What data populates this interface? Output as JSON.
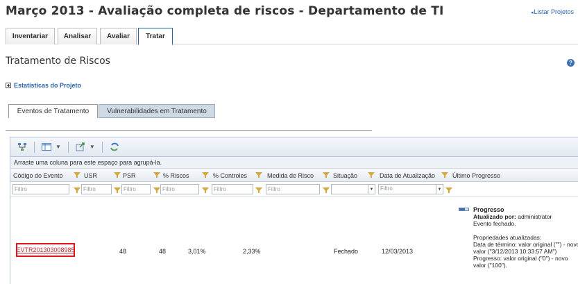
{
  "page": {
    "title": "Março 2013 - Avaliação completa de riscos - Departamento de TI",
    "list_link": "Listar Projetos"
  },
  "main_tabs": [
    {
      "label": "Inventariar"
    },
    {
      "label": "Analisar"
    },
    {
      "label": "Avaliar"
    },
    {
      "label": "Tratar",
      "active": true
    }
  ],
  "section": {
    "title": "Tratamento de Riscos",
    "stats_link": "Estatísticas do Projeto"
  },
  "sub_tabs": [
    {
      "label": "Eventos de Tratamento",
      "active": true
    },
    {
      "label": "Vulnerabilidades em Tratamento"
    }
  ],
  "toolbar": {
    "icons": [
      "hierarchy-icon",
      "columns-icon",
      "export-icon",
      "refresh-icon"
    ]
  },
  "grid": {
    "group_hint": "Arraste uma coluna para este espaço para agrupá-la.",
    "columns": [
      "Código do Evento",
      "USR",
      "PSR",
      "% Riscos",
      "% Controles",
      "Medida de Risco",
      "Situação",
      "Data de Atualização",
      "Último Progresso"
    ],
    "filter_placeholder": "Filtro",
    "rows": [
      {
        "code": "EVTR201303008985",
        "usr": "48",
        "psr": "48",
        "riscos": "3,01%",
        "controles": "2,33%",
        "medida": "",
        "situacao": "Fechado",
        "data": "12/03/2013",
        "progress": {
          "title": "Progresso",
          "by_label": "Atualizado por:",
          "by_value": "administrator",
          "status": "Evento fechado.",
          "props_label": "Propriedades atualizadas:",
          "line1": "Data de término: valor original (\"\") - novo valor (\"3/12/2013 10:33:57 AM\")",
          "line2": "Progresso: valor original (\"0\") - novo valor (\"100\")."
        }
      }
    ]
  },
  "colors": {
    "accent": "#2a62a8",
    "highlight_border": "#e0141a",
    "filter_icon": "#d6a642"
  }
}
